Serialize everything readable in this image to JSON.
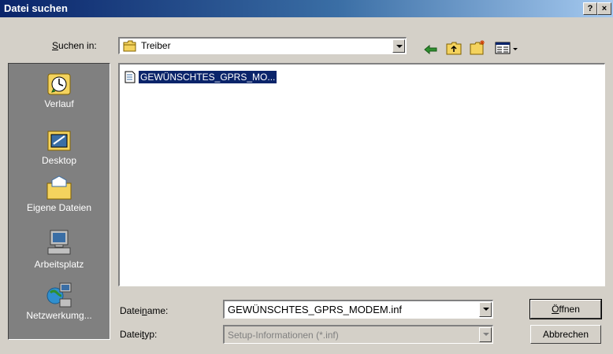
{
  "dialog": {
    "title": "Datei suchen",
    "help_label": "?",
    "close_label": "×"
  },
  "lookin": {
    "label_pre": "",
    "label_u": "S",
    "label_post": "uchen in:",
    "value": "Treiber"
  },
  "places": [
    {
      "label": "Verlauf",
      "icon": "history-icon"
    },
    {
      "label": "Desktop",
      "icon": "desktop-icon"
    },
    {
      "label": "Eigene Dateien",
      "icon": "my-documents-icon"
    },
    {
      "label": "Arbeitsplatz",
      "icon": "my-computer-icon"
    },
    {
      "label": "Netzwerkumg...",
      "icon": "network-icon"
    }
  ],
  "files": [
    {
      "name": "GEWÜNSCHTES_GPRS_MO...",
      "selected": true
    }
  ],
  "filename": {
    "label_pre": "Datei",
    "label_u": "n",
    "label_post": "ame:",
    "value": "GEWÜNSCHTES_GPRS_MODEM.inf"
  },
  "filetype": {
    "label_pre": "Datei",
    "label_u": "t",
    "label_post": "yp:",
    "value": "Setup-Informationen (*.inf)"
  },
  "buttons": {
    "open_u": "Ö",
    "open_rest": "ffnen",
    "cancel": "Abbrechen"
  },
  "colors": {
    "selection": "#0a246a",
    "dialog_face": "#d4d0c8"
  }
}
